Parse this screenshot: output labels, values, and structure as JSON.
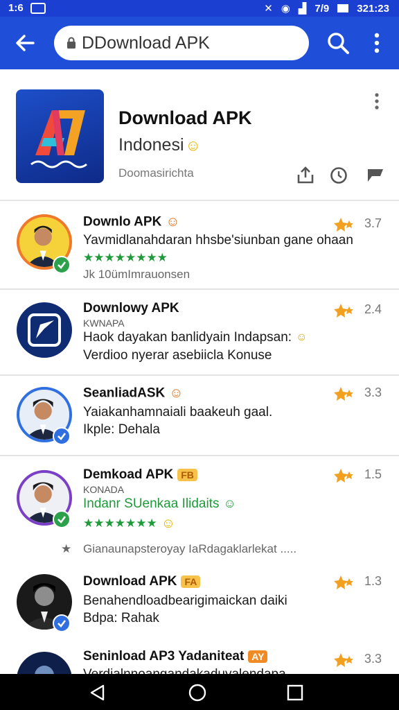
{
  "status_bar": {
    "left_text": "1:6",
    "signal_text": "7/9",
    "time": "321:23"
  },
  "search": {
    "value": "DDownload APK"
  },
  "header": {
    "title": "Download APK",
    "subtitle": "Indonesi",
    "meta": "Doomasirichta"
  },
  "items": [
    {
      "title": "Downlo APK",
      "line1": "Yavmidlanahdaran hhsbe'siunban gane ohaan",
      "stars": "★★★★★★★★",
      "meta": "Jk 10ümImrauonsen",
      "rating": "3.7",
      "ring_color": "#f0782a",
      "verify_color": "#2aa14a"
    },
    {
      "title": "Downlowy APK",
      "small": "KWNAPA",
      "line1": "Haok dayakan banlidyain Indapsan:",
      "line2": "Verdioo nyerar asebiicla Konuse",
      "rating": "2.4"
    },
    {
      "title": "SeanliadASK",
      "line1": "Yaiakanhamnaiali baakeuh gaal.",
      "line2": "Ikple: Dehala",
      "rating": "3.3",
      "ring_color": "#2f6fe0",
      "verify_color": "#2f6fe0"
    },
    {
      "title": "Demkoad APK",
      "tag": "FB",
      "small": "KONADA",
      "green_line": "Indanr SUenkaa Ilidaits",
      "stars": "★★★★★★★",
      "meta": "Gianaunapsteroyay IaRdagaklarlekat .....",
      "rating": "1.5",
      "ring_color": "#7a3fc6",
      "verify_color": "#2aa14a"
    },
    {
      "title": "Download APK",
      "tag": "FA",
      "line1": "Benahendloadbearigimaickan daiki",
      "line2": "Bdpa: Rahak",
      "rating": "1.3",
      "verify_color": "#2f6fe0"
    },
    {
      "title": "Seninload AP3 Yadaniteat",
      "tag": "AY",
      "line1": "Verdialnnoangandakaduyalendapa",
      "rating": "3.3"
    }
  ]
}
